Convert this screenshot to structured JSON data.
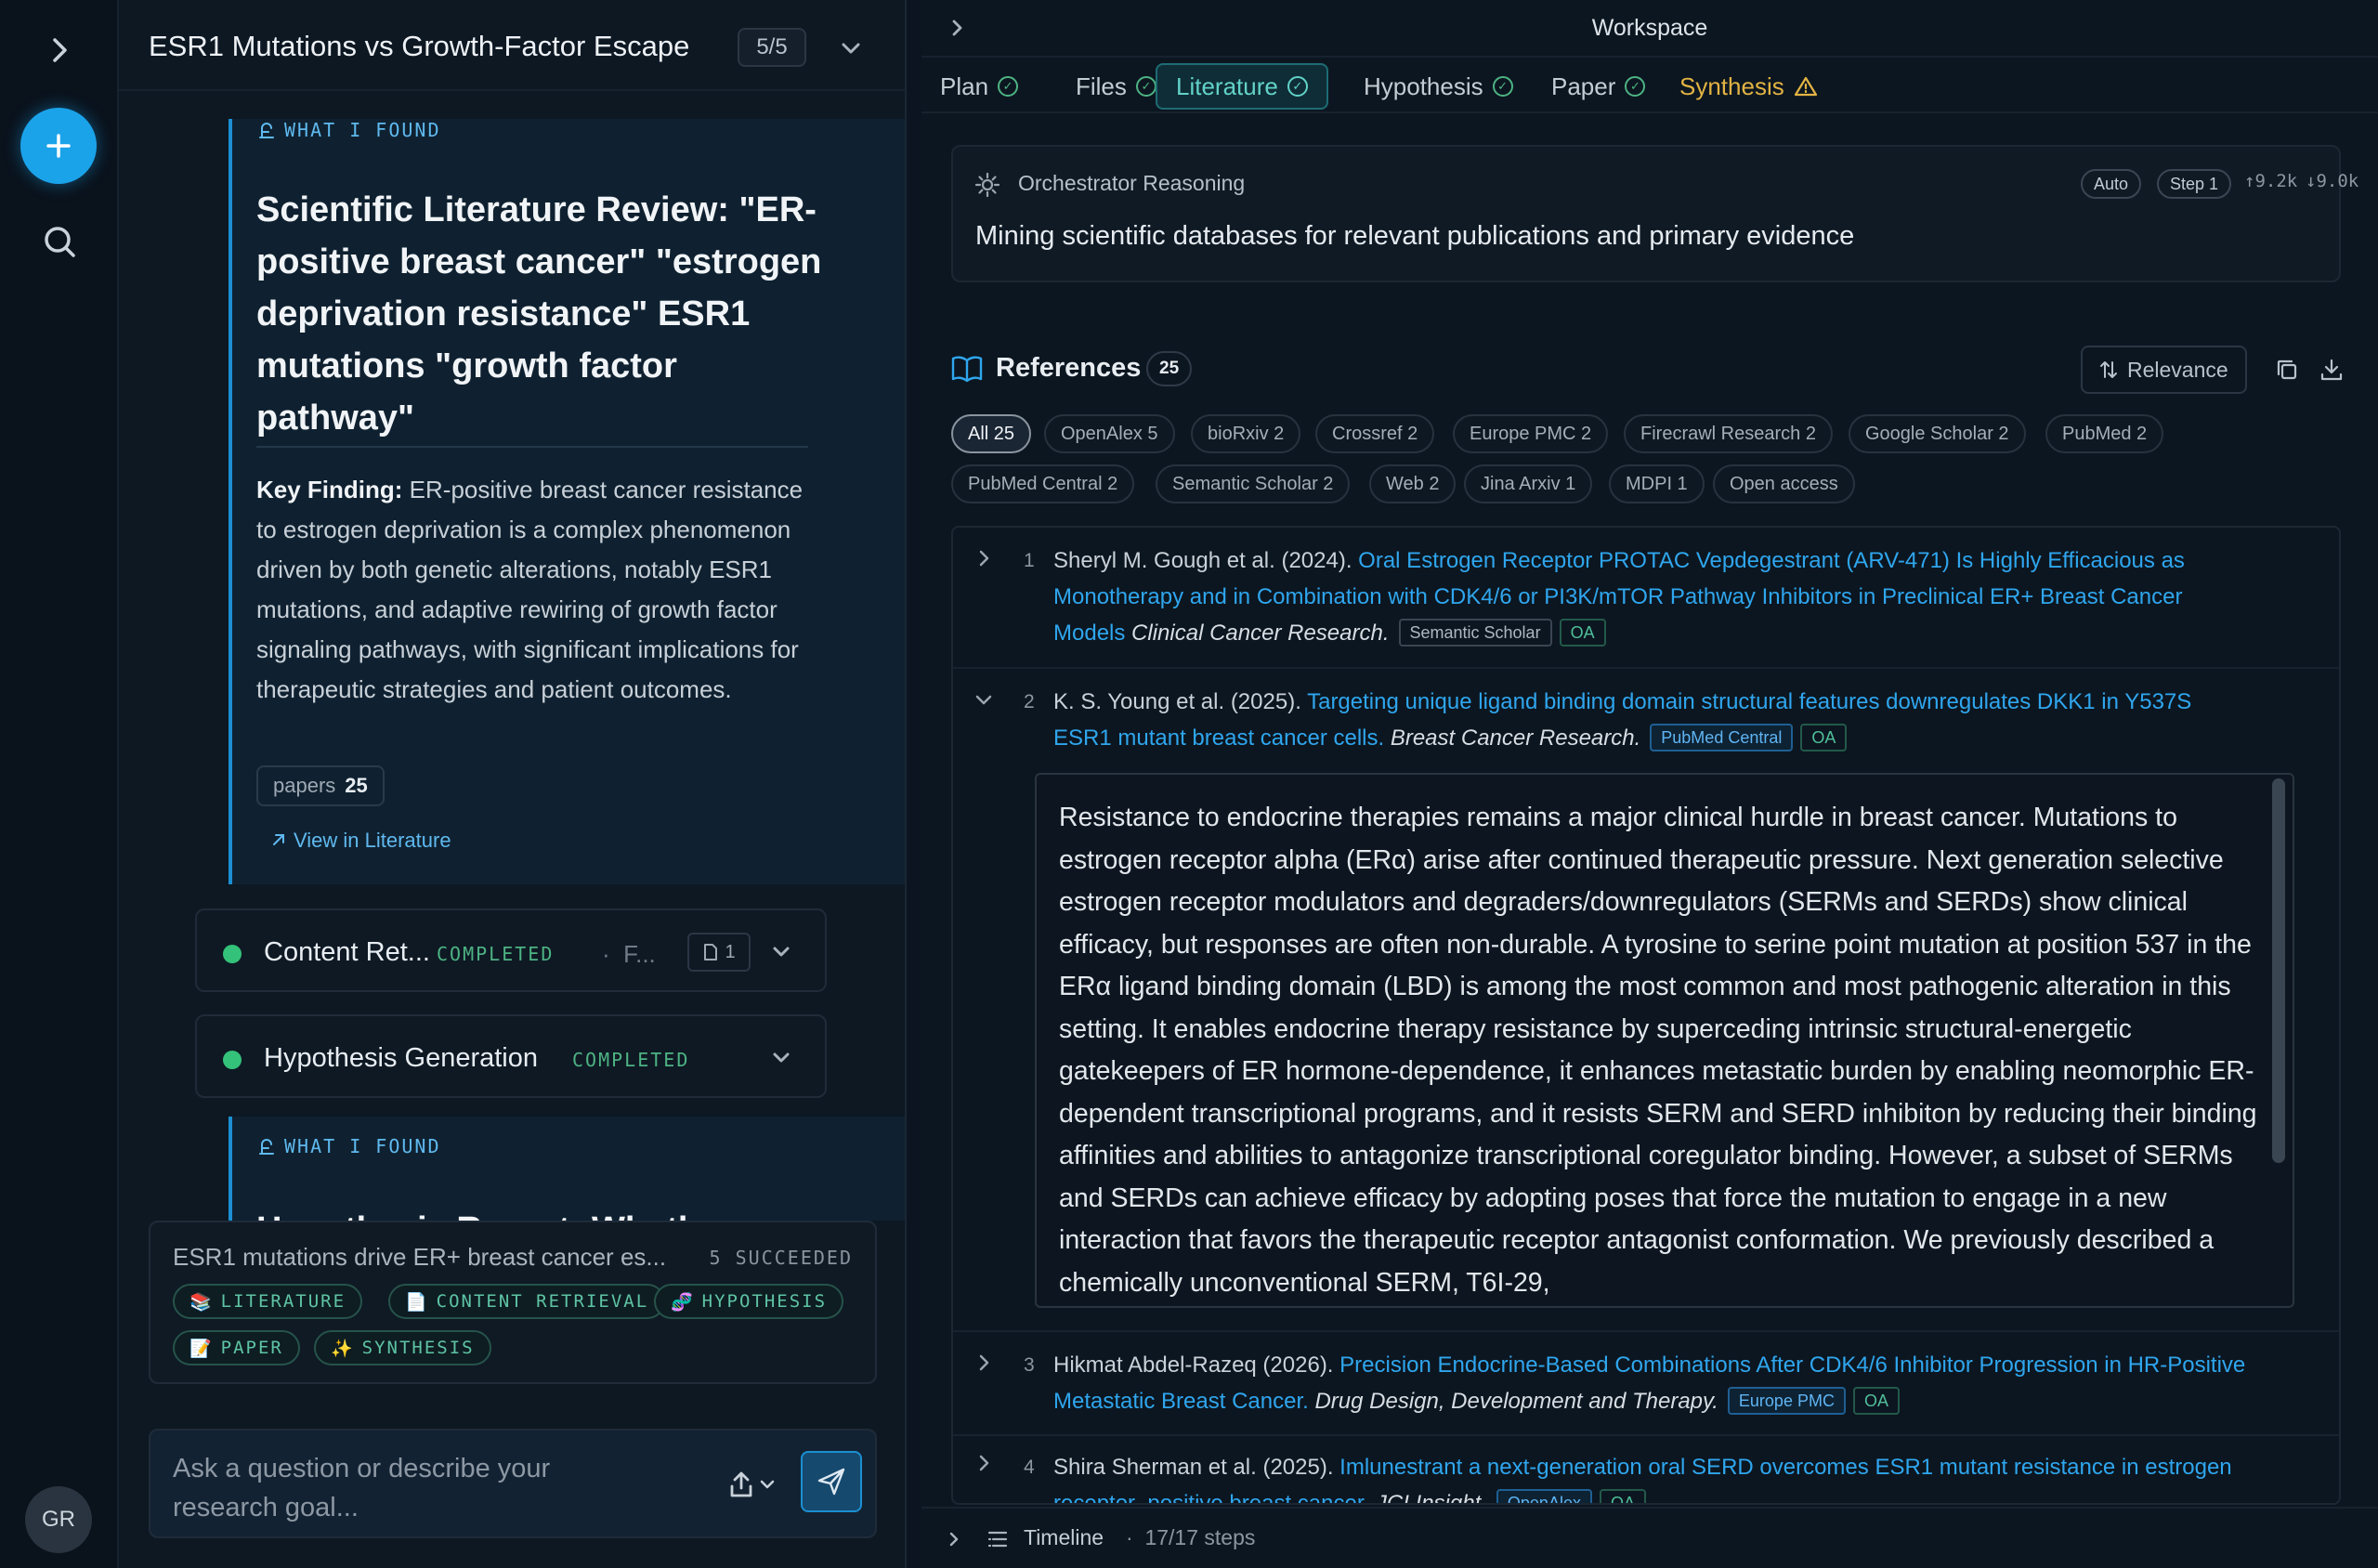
{
  "rail": {
    "avatar_initials": "GR"
  },
  "chat": {
    "title": "ESR1 Mutations vs Growth-Factor Escape",
    "progress": "5/5",
    "what_i_found_label": "WHAT I FOUND",
    "literature_title": "Scientific Literature Review: \"ER-positive breast cancer\" \"estrogen deprivation resistance\" ESR1 mutations \"growth factor pathway\"",
    "key_finding_label": "Key Finding:",
    "key_finding_text": "ER-positive breast cancer resistance to estrogen deprivation is a complex phenomenon driven by both genetic alterations, notably ESR1 mutations, and adaptive rewiring of growth factor signaling pathways, with significant implications for therapeutic strategies and patient outcomes.",
    "papers_label": "papers",
    "papers_count": "25",
    "view_link": "View in Literature",
    "steps": [
      {
        "name": "Content Ret...",
        "status": "COMPLETED",
        "extra": "F...",
        "files": "1"
      },
      {
        "name": "Hypothesis Generation",
        "status": "COMPLETED"
      }
    ],
    "hypothesis_peek_title": "Hypothesis Report: Wheth",
    "summary": {
      "text": "ESR1 mutations drive ER+ breast cancer es...",
      "status": "5 SUCCEEDED",
      "tags": [
        "LITERATURE",
        "CONTENT RETRIEVAL",
        "HYPOTHESIS",
        "PAPER",
        "SYNTHESIS"
      ]
    },
    "composer_placeholder": "Ask a question or describe your research goal..."
  },
  "workspace": {
    "title": "Workspace",
    "tabs": [
      {
        "label": "Plan",
        "state": "ok"
      },
      {
        "label": "Files",
        "state": "ok"
      },
      {
        "label": "Literature",
        "state": "ok"
      },
      {
        "label": "Hypothesis",
        "state": "ok"
      },
      {
        "label": "Paper",
        "state": "ok"
      },
      {
        "label": "Synthesis",
        "state": "warn"
      }
    ],
    "active_tab": "Literature",
    "reasoning": {
      "label": "Orchestrator Reasoning",
      "mode": "Auto",
      "step": "Step 1",
      "tokens_up": "9.2k",
      "tokens_down": "9.0k",
      "text": "Mining scientific databases for relevant publications and primary evidence"
    },
    "references": {
      "title": "References",
      "count": "25",
      "sort_label": "Relevance",
      "filters": [
        "All 25",
        "OpenAlex 5",
        "bioRxiv 2",
        "Crossref 2",
        "Europe PMC 2",
        "Firecrawl Research 2",
        "Google Scholar 2",
        "PubMed 2",
        "PubMed Central 2",
        "Semantic Scholar 2",
        "Web 2",
        "Jina Arxiv 1",
        "MDPI 1",
        "Open access"
      ],
      "items": [
        {
          "num": "1",
          "authors": "Sheryl M. Gough et al. (2024).",
          "title": "Oral Estrogen Receptor PROTAC Vepdegestrant (ARV-471) Is Highly Efficacious as Monotherapy and in Combination with CDK4/6 or PI3K/mTOR Pathway Inhibitors in Preclinical ER+ Breast Cancer Models",
          "journal": "Clinical Cancer Research.",
          "source": "Semantic Scholar",
          "oa": "OA"
        },
        {
          "num": "2",
          "authors": "K. S. Young et al. (2025).",
          "title": "Targeting unique ligand binding domain structural features downregulates DKK1 in Y537S ESR1 mutant breast cancer cells.",
          "journal": "Breast Cancer Research.",
          "source": "PubMed Central",
          "oa": "OA",
          "abstract": "Resistance to endocrine therapies remains a major clinical hurdle in breast cancer. Mutations to estrogen receptor alpha (ERα) arise after continued therapeutic pressure. Next generation selective estrogen receptor modulators and degraders/downregulators (SERMs and SERDs) show clinical efficacy, but responses are often non-durable. A tyrosine to serine point mutation at position 537 in the ERα ligand binding domain (LBD) is among the most common and most pathogenic alteration in this setting. It enables endocrine therapy resistance by superceding intrinsic structural-energetic gatekeepers of ER hormone-dependence, it enhances metastatic burden by enabling neomorphic ER-dependent transcriptional programs, and it resists SERM and SERD inhibiton by reducing their binding affinities and abilities to antagonize transcriptional coregulator binding. However, a subset of SERMs and SERDs can achieve efficacy by adopting poses that force the mutation to engage in a new interaction that favors the therapeutic receptor antagonist conformation. We previously described a chemically unconventional SERM, T6I-29,"
        },
        {
          "num": "3",
          "authors": "Hikmat Abdel-Razeq (2026).",
          "title": "Precision Endocrine-Based Combinations After CDK4/6 Inhibitor Progression in HR-Positive Metastatic Breast Cancer.",
          "journal": "Drug Design, Development and Therapy.",
          "source": "Europe PMC",
          "oa": "OA"
        },
        {
          "num": "4",
          "authors": "Shira Sherman et al. (2025).",
          "title": "Imlunestrant a next-generation oral SERD overcomes ESR1 mutant resistance in estrogen receptor–positive breast cancer.",
          "journal": "JCI Insight.",
          "source": "OpenAlex",
          "oa": "OA"
        }
      ]
    },
    "timeline": {
      "label": "Timeline",
      "steps": "17/17 steps"
    }
  }
}
